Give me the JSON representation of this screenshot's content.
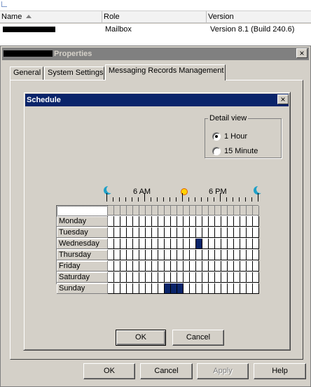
{
  "list": {
    "columns": [
      "Name",
      "Role",
      "Version"
    ],
    "row": {
      "role": "Mailbox",
      "version": "Version 8.1 (Build 240.6)"
    }
  },
  "properties": {
    "title": "Properties",
    "close": "×",
    "tabs": [
      "General",
      "System Settings",
      "Messaging Records Management"
    ],
    "buttons": {
      "ok": "OK",
      "cancel": "Cancel",
      "apply": "Apply",
      "help": "Help"
    }
  },
  "schedule": {
    "title": "Schedule",
    "close": "×",
    "detail_view": {
      "label": "Detail view",
      "options": [
        "1 Hour",
        "15 Minute"
      ],
      "selected": "1 Hour"
    },
    "time_labels": [
      "6 AM",
      "6 PM"
    ],
    "days": [
      "Monday",
      "Tuesday",
      "Wednesday",
      "Thursday",
      "Friday",
      "Saturday",
      "Sunday"
    ],
    "hours_per_day": 24,
    "selected_slots": {
      "Wednesday": [
        14
      ],
      "Sunday": [
        9,
        10,
        11
      ]
    },
    "selected_color": "#0a246a",
    "buttons": {
      "ok": "OK",
      "cancel": "Cancel"
    }
  }
}
